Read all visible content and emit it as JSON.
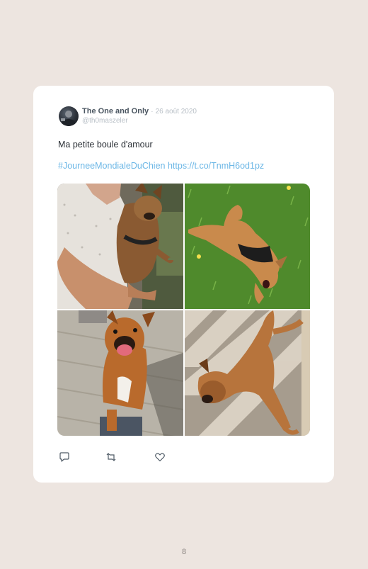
{
  "tweet": {
    "author_name": "The One and Only",
    "separator": "·",
    "date": "26 août 2020",
    "handle": "@th0maszeler",
    "text": "Ma petite boule d'amour",
    "hashtag": "#JourneeMondialeDuChien",
    "link": "https://t.co/TnmH6od1pz",
    "link_color": "#6cb7e6",
    "photos": [
      {
        "icon": "dog-held-photo"
      },
      {
        "icon": "dog-on-grass-photo"
      },
      {
        "icon": "dog-smiling-photo"
      },
      {
        "icon": "dog-lying-on-floor-photo"
      }
    ],
    "actions": [
      {
        "icon": "reply-icon"
      },
      {
        "icon": "retweet-icon"
      },
      {
        "icon": "like-icon"
      }
    ]
  },
  "page": {
    "number": "8",
    "background": "#ede5e0"
  }
}
